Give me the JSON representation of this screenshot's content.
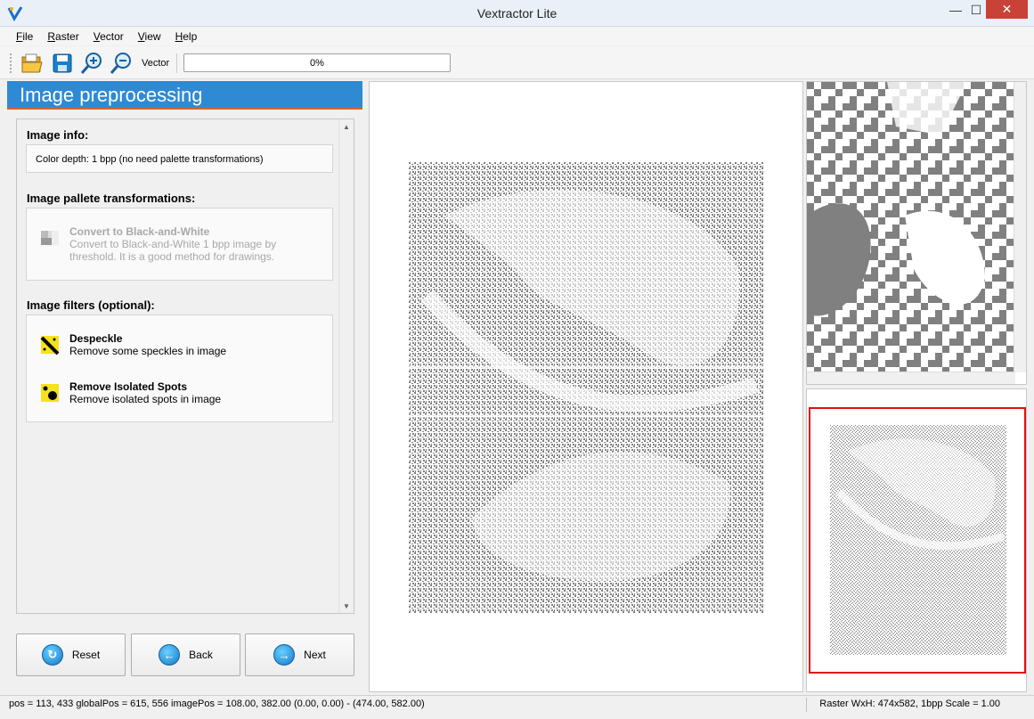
{
  "window": {
    "title": "Vextractor Lite",
    "min_glyph": "—",
    "max_glyph": "☐",
    "close_glyph": "✕"
  },
  "menu": [
    {
      "label": "File",
      "hotkey": "F",
      "rest": "ile"
    },
    {
      "label": "Raster",
      "hotkey": "R",
      "rest": "aster"
    },
    {
      "label": "Vector",
      "hotkey": "V",
      "rest": "ector"
    },
    {
      "label": "View",
      "hotkey": "V",
      "rest": "iew"
    },
    {
      "label": "Help",
      "hotkey": "H",
      "rest": "elp"
    }
  ],
  "toolbar": {
    "icons": [
      "open-folder-icon",
      "save-disk-icon",
      "zoom-in-icon",
      "zoom-out-icon"
    ],
    "vector_label": "Vector",
    "progress_text": "0%",
    "progress_value": 0
  },
  "panel": {
    "title": "Image preprocessing",
    "image_info_title": "Image info:",
    "image_info_text": "Color depth: 1 bpp (no need palette transformations)",
    "palette_title": "Image pallete transformations:",
    "convert_title": "Convert to Black-and-White",
    "convert_desc_1": "Convert to Black-and-White 1 bpp image by",
    "convert_desc_2": "threshold. It is a good method for drawings.",
    "filters_title": "Image filters (optional):",
    "despeckle_title": "Despeckle",
    "despeckle_desc": "Remove some speckles in image",
    "isolated_title": "Remove Isolated Spots",
    "isolated_desc": "Remove isolated spots in image"
  },
  "buttons": {
    "reset": "Reset",
    "back": "Back",
    "next": "Next"
  },
  "status": {
    "left": "pos = 113, 433  globalPos = 615, 556  imagePos = 108.00, 382.00  (0.00, 0.00) - (474.00, 582.00)",
    "right": "Raster WxH: 474x582, 1bpp  Scale = 1.00"
  },
  "colors": {
    "panel_header": "#2f8ad4",
    "thumb_frame": "#e01010",
    "pixel_gray": "#808080"
  }
}
